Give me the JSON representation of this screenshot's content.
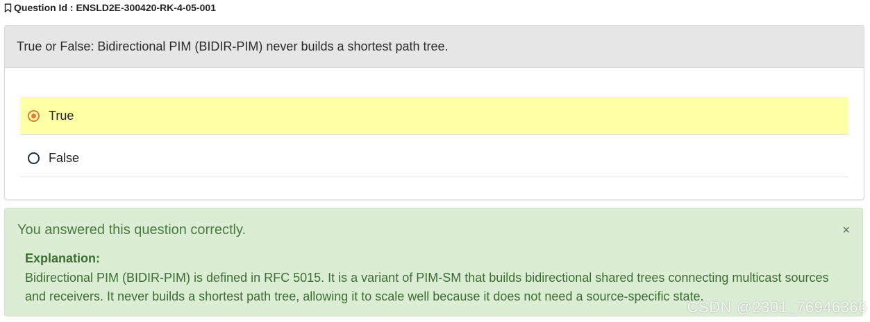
{
  "question": {
    "id_label": "Question Id : ENSLD2E-300420-RK-4-05-001",
    "text": "True or False: Bidirectional PIM (BIDIR-PIM) never builds a shortest path tree."
  },
  "options": [
    {
      "label": "True",
      "selected": true
    },
    {
      "label": "False",
      "selected": false
    }
  ],
  "feedback": {
    "title": "You answered this question correctly.",
    "close": "×",
    "explanation_label": "Explanation:",
    "explanation_text": "Bidirectional PIM (BIDIR-PIM) is defined in RFC 5015. It is a variant of PIM-SM that builds bidirectional shared trees connecting multicast sources and receivers. It never builds a shortest path tree, allowing it to scale well because it does not need a source-specific state."
  },
  "watermark": "CSDN @2301_76946366",
  "colors": {
    "selected_bg": "#ffffa6",
    "radio_checked": "#e07b39",
    "success_bg": "#dcedd6",
    "success_text": "#3c6e31"
  },
  "icons": {
    "question_id": "bookmark-icon"
  }
}
